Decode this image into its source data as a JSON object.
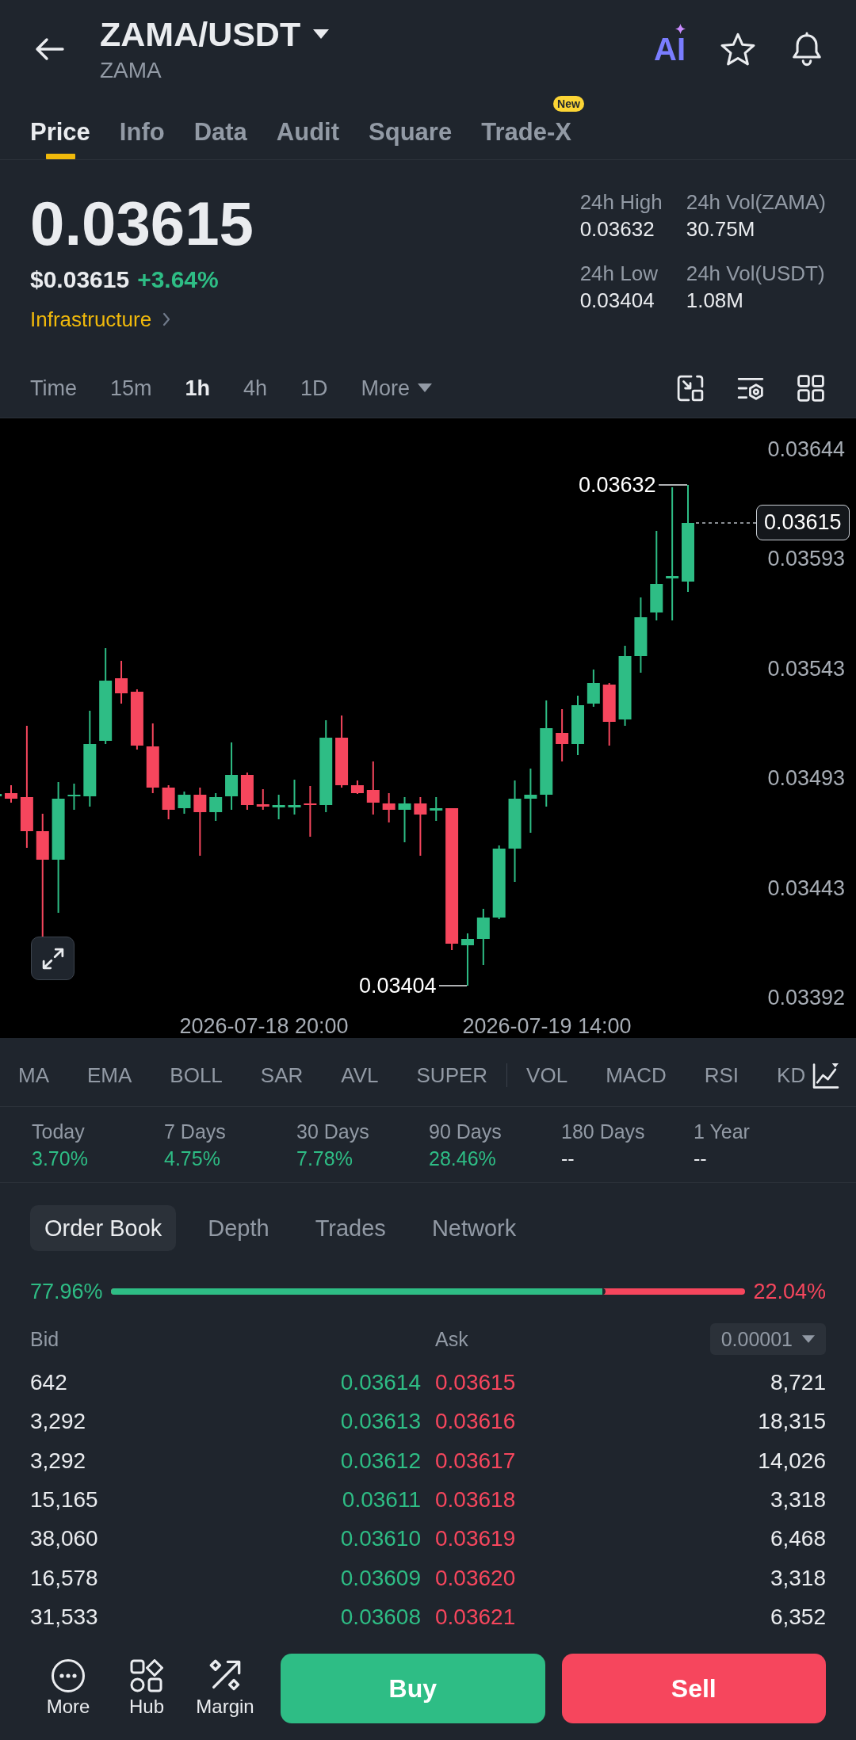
{
  "header": {
    "pair": "ZAMA/USDT",
    "base_asset": "ZAMA",
    "ai_label": "AI"
  },
  "tabs": [
    {
      "label": "Price",
      "selected": true
    },
    {
      "label": "Info",
      "selected": false
    },
    {
      "label": "Data",
      "selected": false
    },
    {
      "label": "Audit",
      "selected": false
    },
    {
      "label": "Square",
      "selected": false
    },
    {
      "label": "Trade-X",
      "selected": false,
      "badge": "New"
    }
  ],
  "price": {
    "last": "0.03615",
    "fiat": "$0.03615",
    "change": "+3.64%",
    "positive": true,
    "sector": "Infrastructure",
    "stats": [
      {
        "label": "24h High",
        "value": "0.03632"
      },
      {
        "label": "24h Vol(ZAMA)",
        "value": "30.75M"
      },
      {
        "label": "24h Low",
        "value": "0.03404"
      },
      {
        "label": "24h Vol(USDT)",
        "value": "1.08M"
      }
    ]
  },
  "intervals": [
    {
      "label": "Time",
      "kind": "option",
      "selected": false
    },
    {
      "label": "15m",
      "kind": "option",
      "selected": false
    },
    {
      "label": "1h",
      "kind": "option",
      "selected": true
    },
    {
      "label": "4h",
      "kind": "option",
      "selected": false
    },
    {
      "label": "1D",
      "kind": "option",
      "selected": false
    },
    {
      "label": "More",
      "kind": "menu",
      "selected": false
    }
  ],
  "chart": {
    "y_axis_labels": [
      "0.03644",
      "0.03593",
      "0.03543",
      "0.03493",
      "0.03443",
      "0.03392"
    ],
    "x_axis_labels": [
      "2026-07-18 20:00",
      "2026-07-19 14:00"
    ],
    "high_marker": "0.03632",
    "low_marker": "0.03404",
    "last_price_tag": "0.03615"
  },
  "indicators": {
    "main": [
      "MA",
      "EMA",
      "BOLL",
      "SAR",
      "AVL",
      "SUPER"
    ],
    "sub": [
      "VOL",
      "MACD",
      "RSI",
      "KD"
    ]
  },
  "performance": [
    {
      "label": "Today",
      "value": "3.70%",
      "positive": true
    },
    {
      "label": "7 Days",
      "value": "4.75%",
      "positive": true
    },
    {
      "label": "30 Days",
      "value": "7.78%",
      "positive": true
    },
    {
      "label": "90 Days",
      "value": "28.46%",
      "positive": true
    },
    {
      "label": "180 Days",
      "value": "--",
      "positive": false
    },
    {
      "label": "1 Year",
      "value": "--",
      "positive": false
    }
  ],
  "order_book": {
    "tabs": [
      {
        "label": "Order Book",
        "selected": true
      },
      {
        "label": "Depth",
        "selected": false
      },
      {
        "label": "Trades",
        "selected": false
      },
      {
        "label": "Network",
        "selected": false
      }
    ],
    "ratio": {
      "bid_share": "77.96%",
      "ask_share": "22.04%",
      "level": 0.7796
    },
    "columns": {
      "bid": "Bid",
      "ask": "Ask"
    },
    "precision": "0.00001",
    "rows": [
      {
        "bid_qty": "642",
        "bid_price": "0.03614",
        "ask_price": "0.03615",
        "ask_qty": "8,721"
      },
      {
        "bid_qty": "3,292",
        "bid_price": "0.03613",
        "ask_price": "0.03616",
        "ask_qty": "18,315"
      },
      {
        "bid_qty": "3,292",
        "bid_price": "0.03612",
        "ask_price": "0.03617",
        "ask_qty": "14,026"
      },
      {
        "bid_qty": "15,165",
        "bid_price": "0.03611",
        "ask_price": "0.03618",
        "ask_qty": "3,318"
      },
      {
        "bid_qty": "38,060",
        "bid_price": "0.03610",
        "ask_price": "0.03619",
        "ask_qty": "6,468"
      },
      {
        "bid_qty": "16,578",
        "bid_price": "0.03609",
        "ask_price": "0.03620",
        "ask_qty": "3,318"
      },
      {
        "bid_qty": "31,533",
        "bid_price": "0.03608",
        "ask_price": "0.03621",
        "ask_qty": "6,352"
      }
    ]
  },
  "bottom_bar": {
    "actions": [
      {
        "label": "More",
        "kind": "more"
      },
      {
        "label": "Hub",
        "kind": "hub"
      },
      {
        "label": "Margin",
        "kind": "margin"
      }
    ],
    "buy": "Buy",
    "sell": "Sell"
  }
}
